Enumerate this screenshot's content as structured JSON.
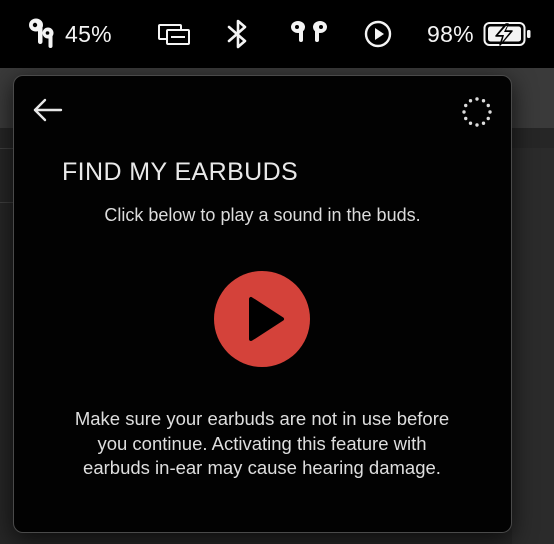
{
  "menubar": {
    "earbuds_battery": "45%",
    "battery_percent": "98%",
    "icons": [
      "earbuds-icon",
      "display-mirroring-icon",
      "bluetooth-icon",
      "airpods-icon",
      "play-circle-icon",
      "battery-charging-icon"
    ]
  },
  "popover": {
    "title": "FIND MY EARBUDS",
    "subtitle": "Click below to play a sound in the buds.",
    "warning": "Make sure your earbuds are not in use before you continue. Activating this feature with earbuds in-ear may cause hearing damage."
  },
  "colors": {
    "play_button": "#d4423a",
    "popover_background": "#020202",
    "menubar_background": "#000000"
  }
}
